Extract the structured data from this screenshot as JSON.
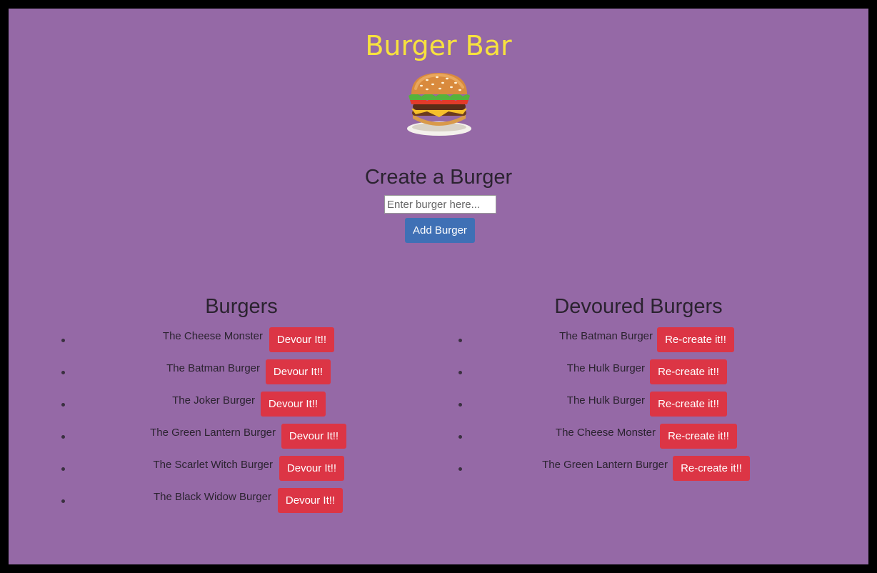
{
  "app": {
    "title": "Burger Bar",
    "logo_icon": "burger-icon"
  },
  "create": {
    "heading": "Create a Burger",
    "input_placeholder": "Enter burger here...",
    "add_label": "Add Burger"
  },
  "burgers": {
    "heading": "Burgers",
    "button_label": "Devour It!!",
    "items": [
      {
        "name": "The Cheese Monster"
      },
      {
        "name": "The Batman Burger"
      },
      {
        "name": "The Joker Burger"
      },
      {
        "name": "The Green Lantern Burger"
      },
      {
        "name": "The Scarlet Witch Burger"
      },
      {
        "name": "The Black Widow Burger"
      }
    ]
  },
  "devoured": {
    "heading": "Devoured Burgers",
    "button_label": "Re-create it!!",
    "items": [
      {
        "name": "The Batman Burger"
      },
      {
        "name": "The Hulk Burger"
      },
      {
        "name": "The Hulk Burger"
      },
      {
        "name": "The Cheese Monster"
      },
      {
        "name": "The Green Lantern Burger"
      }
    ]
  },
  "colors": {
    "background": "#9569a6",
    "title": "#f7e23e",
    "primary_button": "#3f70b5",
    "danger_button": "#dc3545"
  }
}
